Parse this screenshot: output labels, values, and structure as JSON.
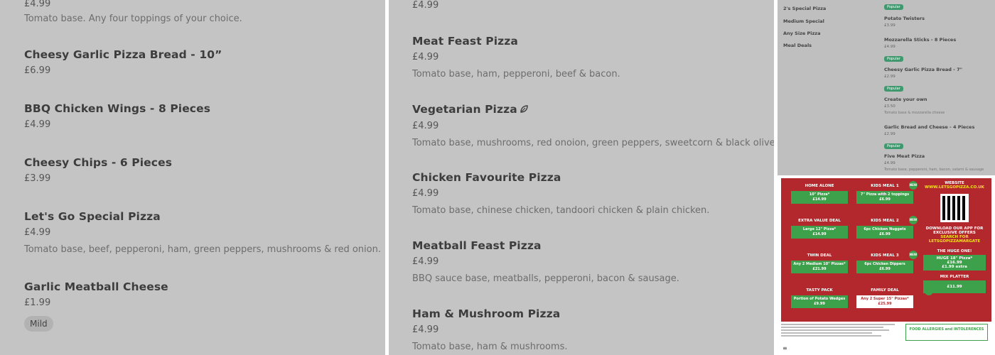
{
  "left_column": {
    "items": [
      {
        "name": "",
        "price": "£4.99",
        "desc": "Tomato base. Any four toppings of your choice."
      },
      {
        "name": "Cheesy Garlic Pizza Bread - 10”",
        "price": "£6.99"
      },
      {
        "name": "BBQ Chicken Wings - 8 Pieces",
        "price": "£4.99"
      },
      {
        "name": "Cheesy Chips - 6 Pieces",
        "price": "£3.99"
      },
      {
        "name": "Let's Go Special Pizza",
        "price": "£4.99",
        "desc": "Tomato base, beef, pepperoni, ham, green peppers, mushrooms & red onion."
      },
      {
        "name": "Garlic Meatball Cheese",
        "price": "£1.99",
        "tag": "Mild"
      }
    ]
  },
  "middle_column": {
    "items": [
      {
        "price": "£4.99"
      },
      {
        "name": "Meat Feast Pizza",
        "price": "£4.99",
        "desc": "Tomato base, ham, pepperoni, beef & bacon."
      },
      {
        "name": "Vegetarian Pizza",
        "price": "£4.99",
        "desc": "Tomato base, mushrooms, red onoion, green peppers, sweetcorn & black olives."
      },
      {
        "name": "Chicken Favourite Pizza",
        "price": "£4.99",
        "desc": "Tomato base, chinese chicken, tandoori chicken & plain chicken."
      },
      {
        "name": "Meatball Feast Pizza",
        "price": "£4.99",
        "desc": "BBQ sauce base, meatballs, pepperoni, bacon & sausage."
      },
      {
        "name": "Ham & Mushroom Pizza",
        "price": "£4.99",
        "desc": "Tomato base, ham & mushrooms."
      }
    ]
  },
  "mini_menu": {
    "categories": [
      "2's Special Pizza",
      "Medium Special",
      "Any Size Pizza",
      "Meal Deals"
    ],
    "items": [
      {
        "name": "",
        "price": "",
        "tag": "Popular"
      },
      {
        "name": "Potato Twisters",
        "price": "£3.99"
      },
      {
        "name": "Mozzarella Sticks - 8 Pieces",
        "price": "£4.99",
        "tag": "Popular"
      },
      {
        "name": "Cheesy Garlic Pizza Bread - 7\"",
        "price": "£2.99",
        "tag": "Popular"
      },
      {
        "name": "Create your own",
        "price": "£3.50",
        "desc": "Tomato base & mozzarella cheese"
      },
      {
        "name": "Garlic Bread and Cheese - 4 Pieces",
        "price": "£2.99",
        "tag": "Popular"
      },
      {
        "name": "Five Meat Pizza",
        "price": "£4.99",
        "desc": "Tomato base, pepperoni, ham, bacon, salami & sausage"
      }
    ]
  },
  "flyer": {
    "deals": [
      {
        "title": "HOME ALONE",
        "body": "10\" Pizza*",
        "price": "£14.99"
      },
      {
        "title": "EXTRA VALUE DEAL",
        "body": "Large 12\" Pizza*",
        "price": "£14.99"
      },
      {
        "title": "TWIN DEAL",
        "body": "Any 2 Medium 10\" Pizzas*",
        "price": "£21.99"
      },
      {
        "title": "TASTY PACK",
        "body": "Portion of Potato Wedges",
        "price": "£9.99"
      },
      {
        "title": "KIDS MEAL 1",
        "body": "7\" Pizza with 2 toppings",
        "price": "£6.99"
      },
      {
        "title": "KIDS MEAL 2",
        "body": "6pc Chicken Nuggets",
        "price": "£6.99"
      },
      {
        "title": "KIDS MEAL 3",
        "body": "6pc Chicken Dippers",
        "price": "£6.99"
      },
      {
        "title": "FAMILY DEAL",
        "body": "Any 2 Super 15\" Pizzas*",
        "price": "£25.99"
      }
    ],
    "website_label": "WEBSITE",
    "website": "WWW.LETSGOPIZZA.CO.UK",
    "app_text": "DOWNLOAD OUR APP FOR EXCLUSIVE OFFERS",
    "search_text": "SEARCH FOR LETSGOPIZZAMARGATE",
    "huge_title": "THE HUGE ONE!",
    "huge_body": "HUGE 18\" Pizza*",
    "huge_price": "£16.99",
    "huge_extra": "£1.99 extra",
    "mix_title": "MIX PLATTER",
    "mix_price": "£11.99",
    "new_label": "NEW",
    "allergy": "FOOD ALLERGIES and INTOLERENCES"
  },
  "colors": {
    "panel_bg": "#c4c4c4",
    "flyer_red": "#b3282d",
    "flyer_green": "#3da04a",
    "popular_green": "#3e9a6e"
  }
}
